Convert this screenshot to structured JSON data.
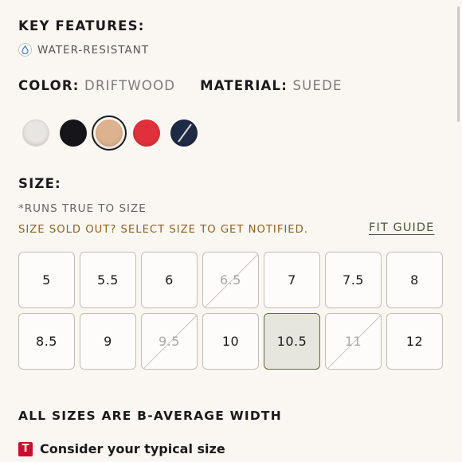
{
  "key_features": {
    "title": "KEY FEATURES:",
    "items": [
      {
        "label": "WATER-RESISTANT",
        "icon": "water-drop-icon"
      }
    ]
  },
  "color": {
    "label": "COLOR:",
    "value": "DRIFTWOOD"
  },
  "material": {
    "label": "MATERIAL:",
    "value": "SUEDE"
  },
  "swatches": [
    {
      "name": "light-grey",
      "color": "#e8e6e3",
      "selected": false
    },
    {
      "name": "black",
      "color": "#16161a",
      "selected": false
    },
    {
      "name": "driftwood",
      "color": "#dcb28f",
      "selected": true
    },
    {
      "name": "red",
      "color": "#e0303b",
      "selected": false
    },
    {
      "name": "navy",
      "color": "#1f2a44",
      "selected": false
    }
  ],
  "size": {
    "title": "SIZE:",
    "note": "*RUNS TRUE TO SIZE",
    "sold_out_note": "SIZE SOLD OUT? SELECT SIZE TO GET NOTIFIED.",
    "fit_guide": "FIT GUIDE",
    "options": [
      {
        "label": "5",
        "sold_out": false,
        "selected": false
      },
      {
        "label": "5.5",
        "sold_out": false,
        "selected": false
      },
      {
        "label": "6",
        "sold_out": false,
        "selected": false
      },
      {
        "label": "6.5",
        "sold_out": true,
        "selected": false
      },
      {
        "label": "7",
        "sold_out": false,
        "selected": false
      },
      {
        "label": "7.5",
        "sold_out": false,
        "selected": false
      },
      {
        "label": "8",
        "sold_out": false,
        "selected": false
      },
      {
        "label": "8.5",
        "sold_out": false,
        "selected": false
      },
      {
        "label": "9",
        "sold_out": false,
        "selected": false
      },
      {
        "label": "9.5",
        "sold_out": true,
        "selected": false
      },
      {
        "label": "10",
        "sold_out": false,
        "selected": false
      },
      {
        "label": "10.5",
        "sold_out": false,
        "selected": true
      },
      {
        "label": "11",
        "sold_out": true,
        "selected": false
      },
      {
        "label": "12",
        "sold_out": false,
        "selected": false
      }
    ]
  },
  "width_note": "ALL SIZES ARE B-AVERAGE WIDTH",
  "tip": {
    "badge": "T",
    "text": "Consider your typical size"
  }
}
